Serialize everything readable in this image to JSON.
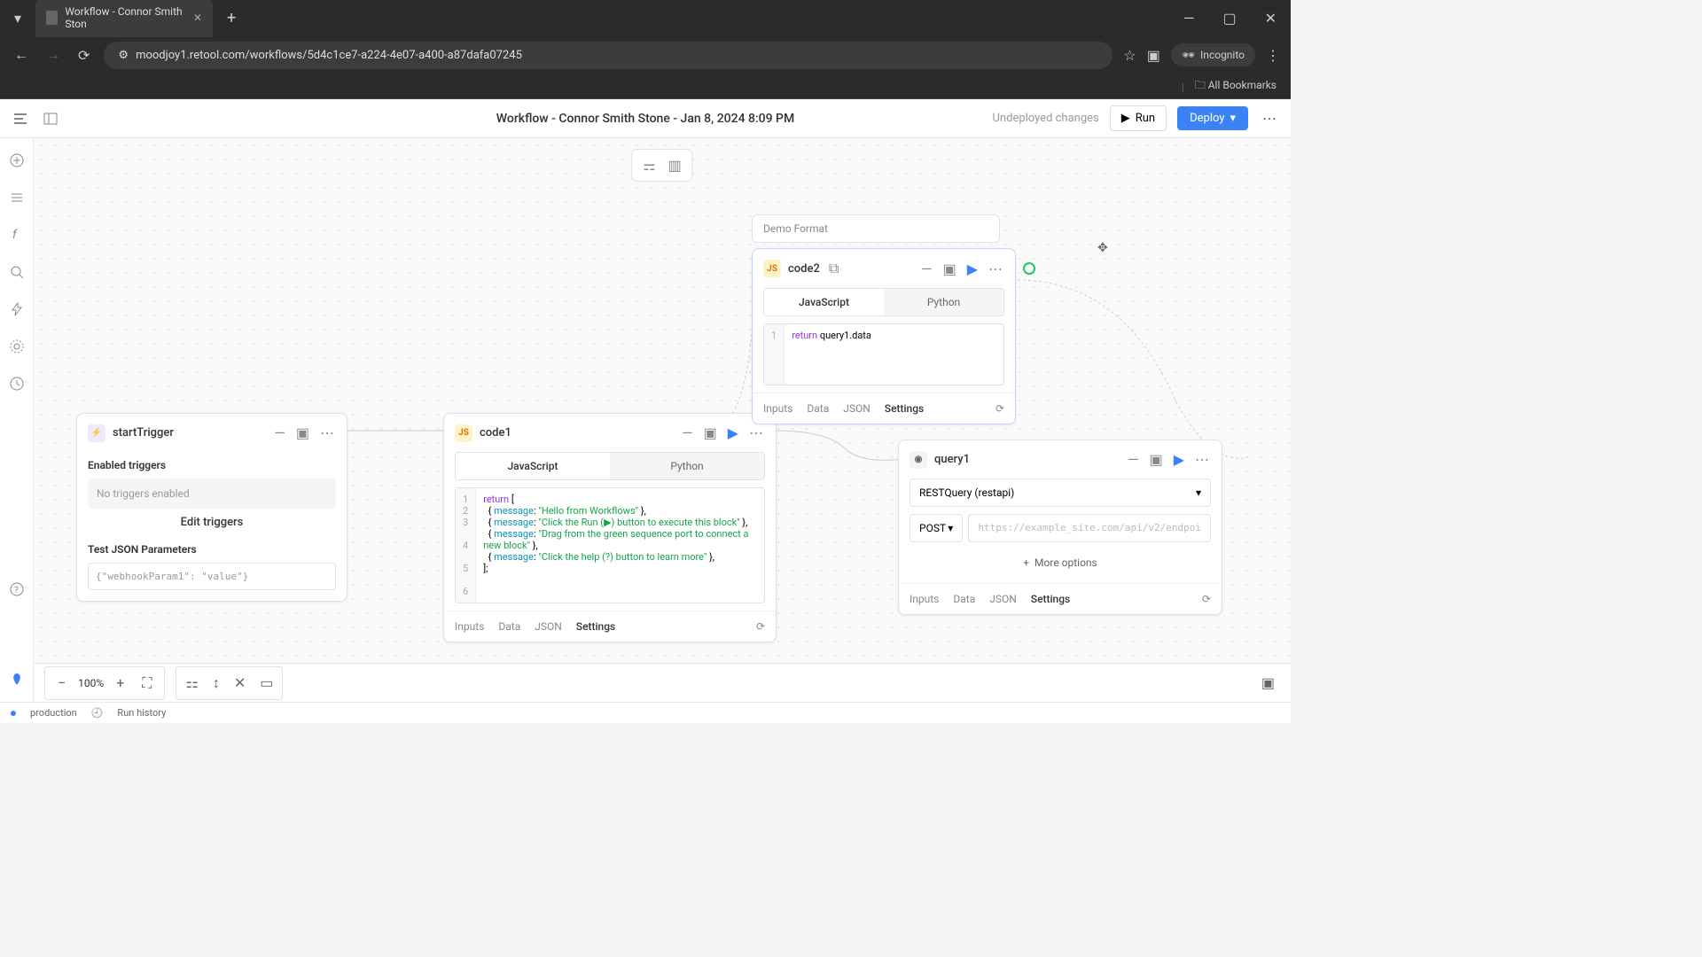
{
  "browser": {
    "tab_title": "Workflow - Connor Smith Ston",
    "url": "moodjoy1.retool.com/workflows/5d4c1ce7-a224-4e07-a400-a87dafa07245",
    "incognito_label": "Incognito",
    "all_bookmarks": "All Bookmarks"
  },
  "header": {
    "title": "Workflow - Connor Smith Stone - Jan 8, 2024 8:09 PM",
    "status": "Undeployed changes",
    "run_label": "Run",
    "deploy_label": "Deploy"
  },
  "tooltip": {
    "label": "Demo Format"
  },
  "nodes": {
    "startTrigger": {
      "title": "startTrigger",
      "enabled_label": "Enabled triggers",
      "no_triggers": "No triggers enabled",
      "edit_link": "Edit triggers",
      "test_params_label": "Test JSON Parameters",
      "json_placeholder": "{\"webhookParam1\": \"value\"}"
    },
    "code1": {
      "title": "code1",
      "tabs": {
        "js": "JavaScript",
        "py": "Python"
      },
      "lines": [
        "1",
        "2",
        "3",
        "4",
        "5",
        "6"
      ],
      "footer": {
        "inputs": "Inputs",
        "data": "Data",
        "json": "JSON",
        "settings": "Settings"
      }
    },
    "code2": {
      "title": "code2",
      "tabs": {
        "js": "JavaScript",
        "py": "Python"
      },
      "lines": [
        "1"
      ],
      "code_return": "return",
      "code_rest": " query1.data",
      "footer": {
        "inputs": "Inputs",
        "data": "Data",
        "json": "JSON",
        "settings": "Settings"
      }
    },
    "query1": {
      "title": "query1",
      "resource": "RESTQuery (restapi)",
      "method": "POST",
      "url_placeholder": "https://example_site.com/api/v2/endpoi",
      "more_options": "More options",
      "footer": {
        "inputs": "Inputs",
        "data": "Data",
        "json": "JSON",
        "settings": "Settings"
      }
    }
  },
  "bottom": {
    "zoom": "100%"
  },
  "status": {
    "env": "production",
    "history": "Run history"
  },
  "code1_src": {
    "l1_kw": "return",
    "l1_rest": " [",
    "l2_pre": "  { ",
    "l2_prop": "message",
    "l2_mid": ": ",
    "l2_str": "\"Hello from Workflows\"",
    "l2_post": " },",
    "l3_pre": "  { ",
    "l3_prop": "message",
    "l3_mid": ": ",
    "l3_str": "\"Click the Run (▶) button to execute this block\"",
    "l3_post": " },",
    "l4_pre": "  { ",
    "l4_prop": "message",
    "l4_mid": ": ",
    "l4_str": "\"Drag from the green sequence port to connect a new block\"",
    "l4_post": " },",
    "l5_pre": "  { ",
    "l5_prop": "message",
    "l5_mid": ": ",
    "l5_str": "\"Click the help (?) button to learn more\"",
    "l5_post": " },",
    "l6": "];"
  }
}
